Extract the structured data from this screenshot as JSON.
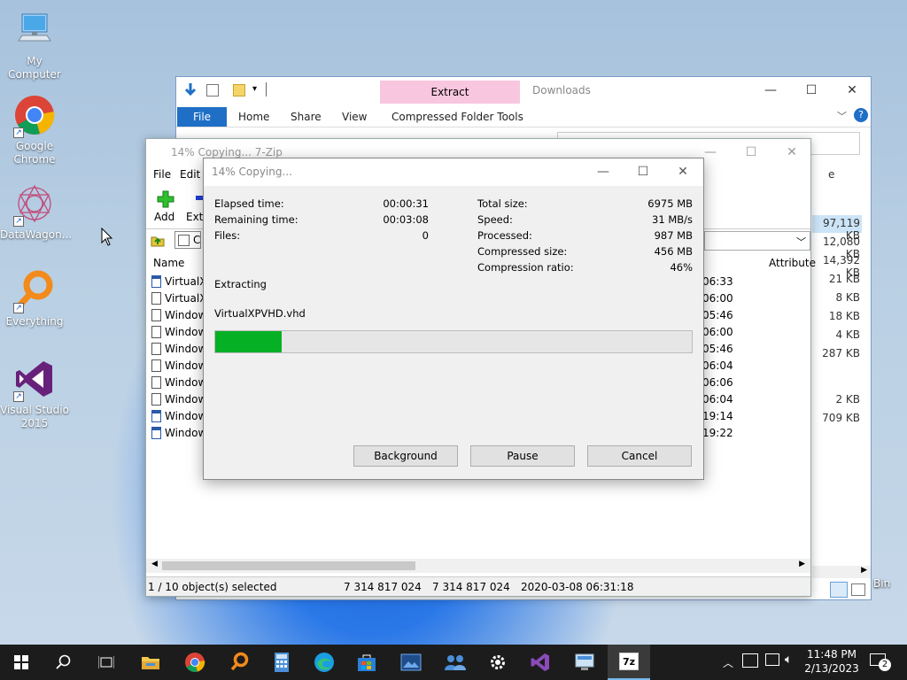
{
  "desktop": {
    "icons": [
      {
        "label": "My Computer"
      },
      {
        "label": "Google Chrome"
      },
      {
        "label": "DataWagon..."
      },
      {
        "label": "Everything"
      },
      {
        "label": "Visual Studio 2015"
      }
    ],
    "recycle_bin_label": "Bin"
  },
  "explorer": {
    "contextual_tab_group": "Extract",
    "window_title": "Downloads",
    "tabs": [
      "File",
      "Home",
      "Share",
      "View",
      "Compressed Folder Tools"
    ],
    "right_column_sizes": [
      "97,119 KB",
      "12,080 KB",
      "14,392 KB",
      "21 KB",
      "8 KB",
      "18 KB",
      "4 KB",
      "287 KB",
      "2 KB",
      "709 KB"
    ],
    "partial_header": "e"
  },
  "sevenzip": {
    "title": "14% Copying... 7-Zip",
    "menu": [
      "File",
      "Edit"
    ],
    "toolbar": {
      "add": "Add",
      "extract": "Extr"
    },
    "path_partial": "C",
    "columns": {
      "name": "Name",
      "attributes": "Attribute"
    },
    "rows": [
      {
        "name": "VirtualX",
        "time": "06:33",
        "vhd": true
      },
      {
        "name": "VirtualX",
        "time": "06:00",
        "vhd": false
      },
      {
        "name": "Window",
        "time": "05:46",
        "vhd": false
      },
      {
        "name": "Window",
        "time": "06:00",
        "vhd": false
      },
      {
        "name": "Window",
        "time": "05:46",
        "vhd": false
      },
      {
        "name": "Window",
        "time": "06:04",
        "vhd": false
      },
      {
        "name": "Window",
        "time": "06:06",
        "vhd": false
      },
      {
        "name": "Window",
        "time": "06:04",
        "vhd": false
      },
      {
        "name": "Window",
        "time": "19:14",
        "vhd": true
      },
      {
        "name": "Window",
        "time": "19:22",
        "vhd": true
      }
    ],
    "status": {
      "selected": "1 / 10 object(s) selected",
      "size1": "7 314 817 024",
      "size2": "7 314 817 024",
      "modified": "2020-03-08 06:31:18"
    }
  },
  "dialog": {
    "title": "14% Copying...",
    "left_labels": [
      "Elapsed time:",
      "Remaining time:",
      "Files:"
    ],
    "left_values": [
      "00:00:31",
      "00:03:08",
      "0"
    ],
    "right_labels": [
      "Total size:",
      "Speed:",
      "Processed:",
      "Compressed size:",
      "Compression ratio:"
    ],
    "right_values": [
      "6975 MB",
      "31 MB/s",
      "987 MB",
      "456 MB",
      "46%"
    ],
    "operation": "Extracting",
    "current_file": "VirtualXPVHD.vhd",
    "progress_percent": 14,
    "buttons": {
      "background": "Background",
      "pause": "Pause",
      "cancel": "Cancel"
    },
    "progress_color": "#06b025"
  },
  "taskbar": {
    "time": "11:48 PM",
    "date": "2/13/2023",
    "notification_count": "2"
  }
}
